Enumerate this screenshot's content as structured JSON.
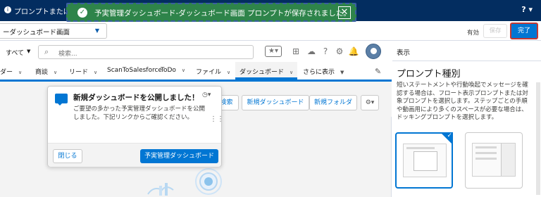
{
  "topbar": {
    "title": "プロンプトまたは",
    "help_label": "? ▾"
  },
  "toast": {
    "message": "予実管理ダッシュボード-ダッシュボード画面 プロンプトが保存されました。",
    "close_label": "✕"
  },
  "builder": {
    "page_select_value": "ーダッシュボード画面",
    "status_label": "有効",
    "save_label": "保存",
    "done_label": "完了"
  },
  "header": {
    "scope_label": "すべて",
    "search_placeholder": "検索..."
  },
  "nav": {
    "items": [
      {
        "label": "ダー"
      },
      {
        "label": "商談"
      },
      {
        "label": "リード"
      },
      {
        "label": "ScanToSalesforce"
      },
      {
        "label": "ToDo"
      },
      {
        "label": "ファイル"
      },
      {
        "label": "ダッシュボード"
      },
      {
        "label": "さらに表示"
      }
    ]
  },
  "list_header": {
    "search_partial": "検索",
    "new_dashboard_label": "新規ダッシュボード",
    "new_folder_label": "新規フォルダ"
  },
  "popover": {
    "title": "新規ダッシュボードを公開しました！",
    "body": "ご要望の多かった予実管理ダッシュボードを公開しました。下記リンクからご確認ください。",
    "close_label": "閉じる",
    "cta_label": "予実管理ダッシュボード"
  },
  "panel": {
    "label": "表示",
    "heading": "プロンプト種別",
    "description": "短いステートメントや行動喚起でメッセージを確認する場合は、フロート表示プロンプトまたは対象プロンプトを選択します。ステップごとの手順や動画用により多くのスペースが必要な場合は、ドッキングプロンプトを選択します。"
  },
  "colors": {
    "topbar": "#032d60",
    "toast": "#2e844a",
    "brand": "#0176d3",
    "done_outline": "#c23934"
  }
}
